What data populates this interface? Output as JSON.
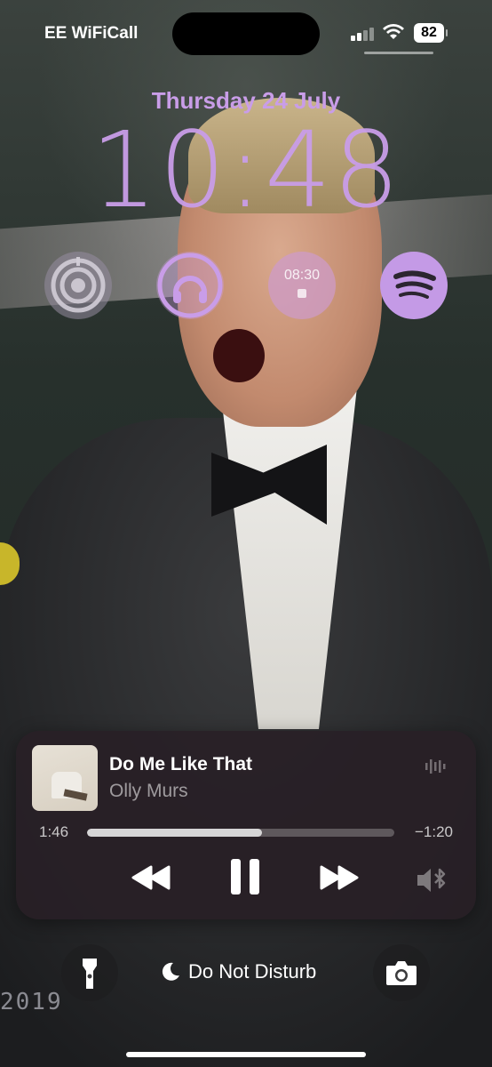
{
  "status_bar": {
    "carrier": "EE WiFiCall",
    "battery_percent": "82",
    "signal_bars": 2,
    "signal_bars_total": 4
  },
  "lock_screen": {
    "date": "Thursday 24 July",
    "time": "10:48"
  },
  "widgets": [
    {
      "name": "target-rings-widget",
      "icon": "concentric-rings-icon"
    },
    {
      "name": "headphones-widget",
      "icon": "headphones-icon"
    },
    {
      "name": "alarm-widget",
      "label": "08:30",
      "icon": "alarm-icon"
    },
    {
      "name": "spotify-widget",
      "icon": "spotify-icon"
    }
  ],
  "now_playing": {
    "title": "Do Me Like That",
    "artist": "Olly Murs",
    "elapsed": "1:46",
    "remaining": "−1:20",
    "progress_fraction": 0.57
  },
  "bottom_controls": {
    "focus_mode": "Do Not Disturb"
  },
  "wallpaper": {
    "stage_text": "2019"
  },
  "colors": {
    "accent": "#c99de8"
  }
}
